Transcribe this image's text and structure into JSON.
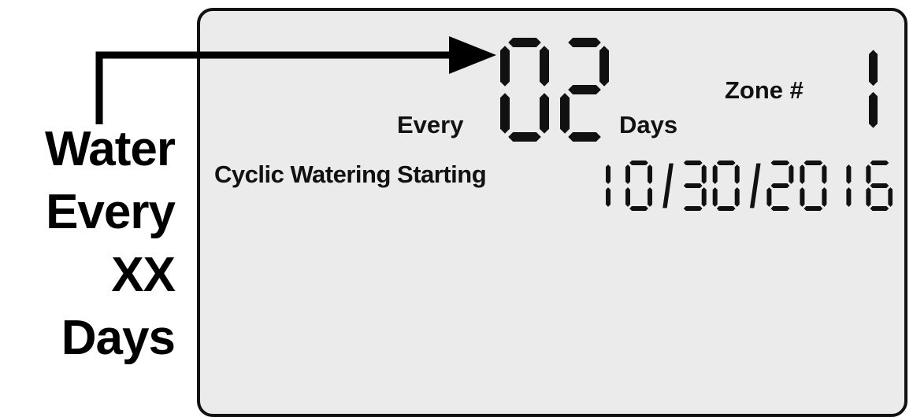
{
  "callout": {
    "lines": [
      "Water",
      "Every",
      "XX",
      "Days"
    ]
  },
  "display": {
    "interval_value": "02",
    "every_label": "Every",
    "days_label": "Days",
    "zone_label": "Zone #",
    "zone_value": "1",
    "cyclic_label": "Cyclic Watering Starting",
    "start_date": "10/30/2016"
  },
  "colors": {
    "lcd_background": "#ebebeb",
    "segment": "#111111",
    "text": "#000000"
  }
}
